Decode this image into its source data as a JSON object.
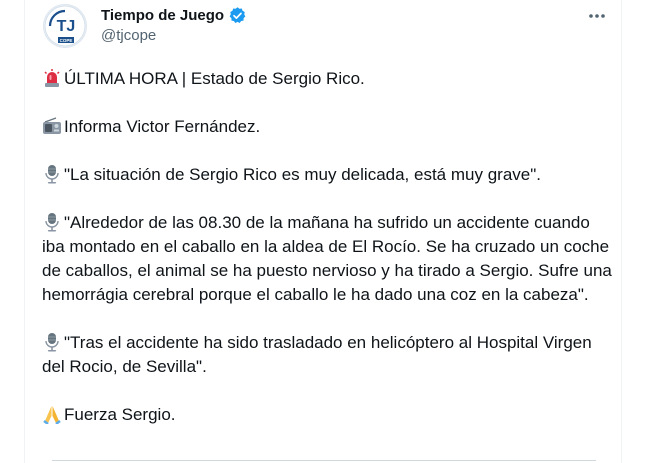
{
  "author": {
    "name": "Tiempo de Juego",
    "handle": "@tjcope",
    "avatar_logo_text": "TJ",
    "avatar_subtext": "COPE",
    "verified_icon": "verified-badge-icon",
    "verified_color": "#1d9bf0"
  },
  "more_icon": "more-options-icon",
  "tweet": {
    "paragraphs": [
      {
        "icon": "rotating-light-icon",
        "text": "ÚLTIMA HORA | Estado de Sergio Rico."
      },
      {
        "icon": "radio-icon",
        "text": "Informa Victor Fernández."
      },
      {
        "icon": "microphone-icon",
        "text": "\"La situación de Sergio Rico es muy delicada, está muy grave\"."
      },
      {
        "icon": "microphone-icon",
        "text": "\"Alrededor de las 08.30 de la mañana ha sufrido un accidente cuando iba montado en el caballo en la aldea de El Rocío. Se ha cruzado un coche de caballos, el animal se ha puesto nervioso y ha tirado a Sergio. Sufre una hemorrágia cerebral porque el caballo le ha dado una coz en la cabeza\"."
      },
      {
        "icon": "microphone-icon",
        "text": "\"Tras el accidente ha sido trasladado en helicóptero al Hospital Virgen del Rocio, de Sevilla\"."
      },
      {
        "icon": "folded-hands-icon",
        "text": "Fuerza Sergio."
      }
    ]
  }
}
